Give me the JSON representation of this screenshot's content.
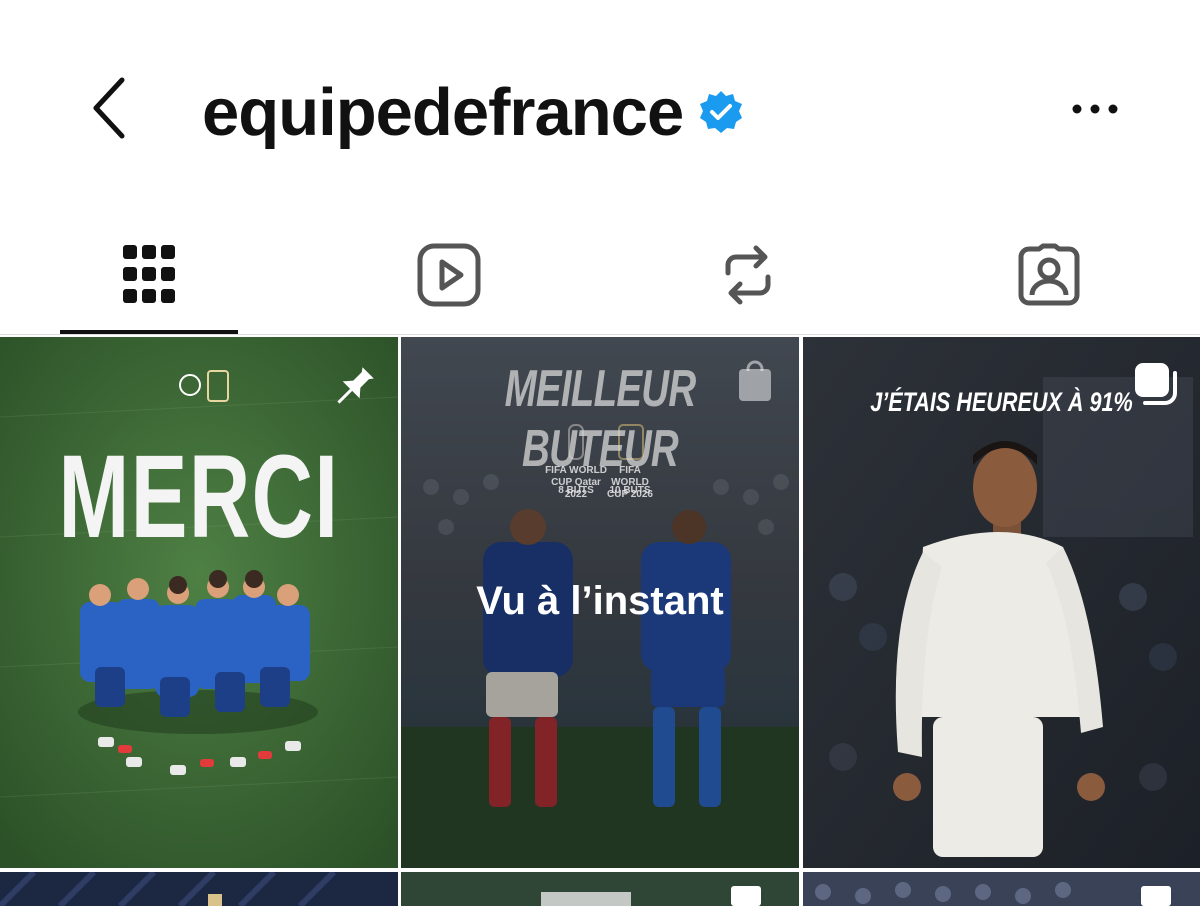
{
  "header": {
    "username": "equipedefrance",
    "verified": true,
    "accent_color": "#1a9bf0",
    "icons": {
      "back": "chevron-left-icon",
      "more": "more-horizontal-icon"
    }
  },
  "tabs": [
    {
      "name": "posts-grid",
      "icon": "grid-icon",
      "active": true
    },
    {
      "name": "reels",
      "icon": "reels-icon",
      "active": false
    },
    {
      "name": "reposts",
      "icon": "repost-icon",
      "active": false
    },
    {
      "name": "tagged",
      "icon": "tagged-icon",
      "active": false
    }
  ],
  "posts": [
    {
      "headline": "MERCI",
      "overlay_icon": "pin-icon"
    },
    {
      "headline": "MEILLEUR BUTEUR",
      "seen_label": "Vu à l’instant",
      "overlay_icon": "shopping-bag-icon",
      "stats": [
        "FIFA WORLD CUP Qatar 2022",
        "8 BUTS",
        "FIFA WORLD CUP 2026",
        "10 BUTS"
      ]
    },
    {
      "headline": "J’ÉTAIS HEUREUX À 91%",
      "overlay_icon": "carousel-icon"
    }
  ]
}
